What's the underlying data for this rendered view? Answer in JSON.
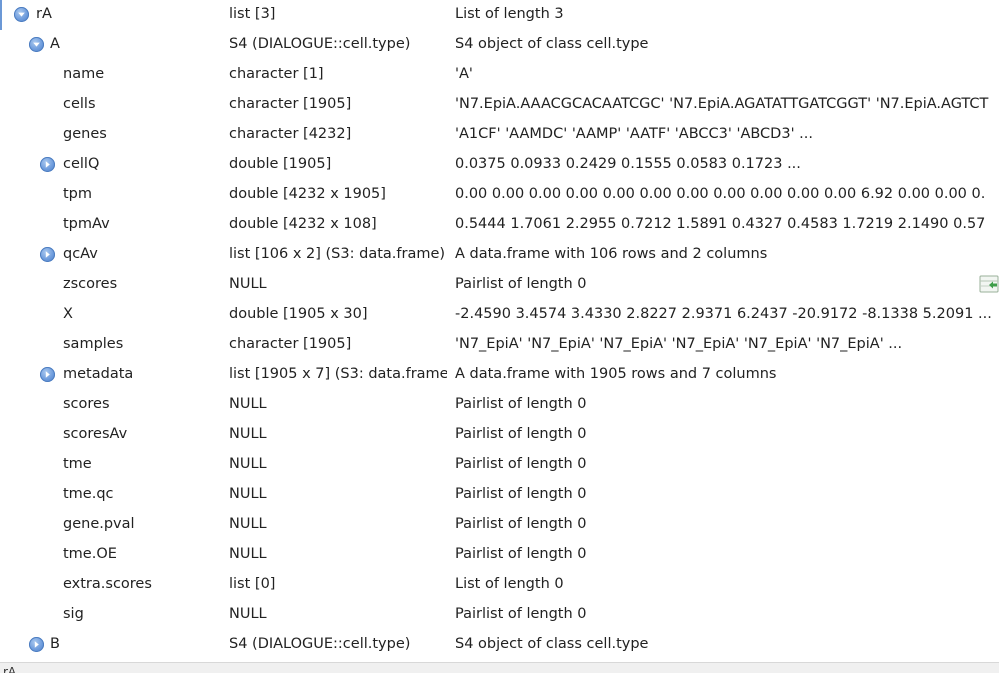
{
  "rows": [
    {
      "name": "rA",
      "type": "list [3]",
      "value": "List of length 3"
    },
    {
      "name": "A",
      "type": "S4 (DIALOGUE::cell.type)",
      "value": "S4 object of class cell.type"
    },
    {
      "name": "name",
      "type": "character [1]",
      "value": "'A'"
    },
    {
      "name": "cells",
      "type": "character [1905]",
      "value": "'N7.EpiA.AAACGCACAATCGC' 'N7.EpiA.AGATATTGATCGGT' 'N7.EpiA.AGTCT"
    },
    {
      "name": "genes",
      "type": "character [4232]",
      "value": "'A1CF' 'AAMDC' 'AAMP' 'AATF' 'ABCC3' 'ABCD3' ..."
    },
    {
      "name": "cellQ",
      "type": "double [1905]",
      "value": "0.0375 0.0933 0.2429 0.1555 0.0583 0.1723 ..."
    },
    {
      "name": "tpm",
      "type": "double [4232 x 1905]",
      "value": "0.00 0.00 0.00 0.00 0.00 0.00 0.00 0.00 0.00 0.00 0.00 6.92 0.00 0.00 0."
    },
    {
      "name": "tpmAv",
      "type": "double [4232 x 108]",
      "value": "0.5444 1.7061 2.2955 0.7212 1.5891 0.4327 0.4583 1.7219 2.1490 0.57"
    },
    {
      "name": "qcAv",
      "type": "list [106 x 2] (S3: data.frame)",
      "value": "A data.frame with 106 rows and 2 columns"
    },
    {
      "name": "zscores",
      "type": "NULL",
      "value": "Pairlist of length 0"
    },
    {
      "name": "X",
      "type": "double [1905 x 30]",
      "value": "-2.4590 3.4574 3.4330 2.8227 2.9371 6.2437 -20.9172 -8.1338 5.2091 ..."
    },
    {
      "name": "samples",
      "type": "character [1905]",
      "value": "'N7_EpiA' 'N7_EpiA' 'N7_EpiA' 'N7_EpiA' 'N7_EpiA' 'N7_EpiA' ..."
    },
    {
      "name": "metadata",
      "type": "list [1905 x 7] (S3: data.frame)",
      "value": "A data.frame with 1905 rows and 7 columns"
    },
    {
      "name": "scores",
      "type": "NULL",
      "value": "Pairlist of length 0"
    },
    {
      "name": "scoresAv",
      "type": "NULL",
      "value": "Pairlist of length 0"
    },
    {
      "name": "tme",
      "type": "NULL",
      "value": "Pairlist of length 0"
    },
    {
      "name": "tme.qc",
      "type": "NULL",
      "value": "Pairlist of length 0"
    },
    {
      "name": "gene.pval",
      "type": "NULL",
      "value": "Pairlist of length 0"
    },
    {
      "name": "tme.OE",
      "type": "NULL",
      "value": "Pairlist of length 0"
    },
    {
      "name": "extra.scores",
      "type": "list [0]",
      "value": "List of length 0"
    },
    {
      "name": "sig",
      "type": "NULL",
      "value": "Pairlist of length 0"
    },
    {
      "name": "B",
      "type": "S4 (DIALOGUE::cell.type)",
      "value": "S4 object of class cell.type"
    }
  ],
  "status": {
    "label": "rA"
  },
  "icons": {
    "expanded": "expanded-toggle-icon",
    "collapsed": "collapsed-toggle-icon",
    "side_button": "open-data-viewer-icon"
  },
  "colors": {
    "toggle": "#6d9bdc",
    "text": "#222222",
    "status_bg": "#f0f0f0"
  }
}
